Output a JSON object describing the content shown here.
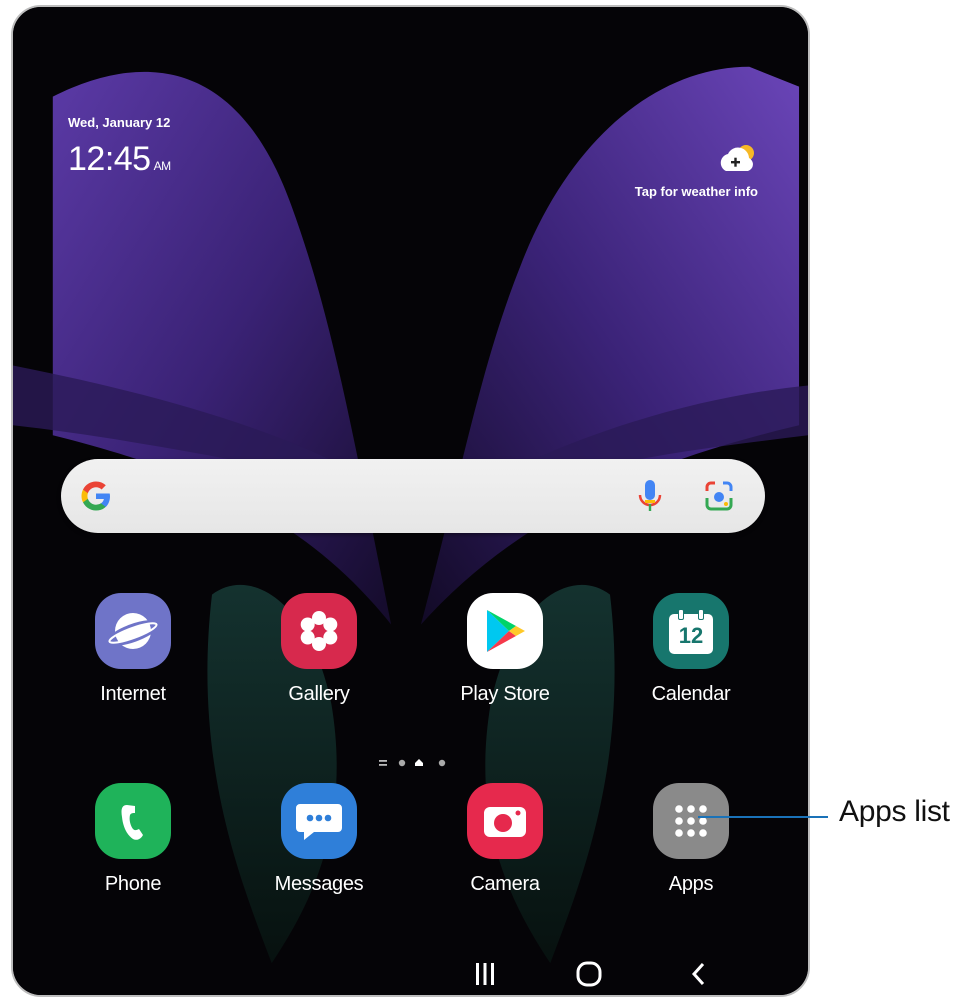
{
  "lockscreen": {
    "date": "Wed, January 12",
    "time": "12:45",
    "ampm": "AM",
    "weather_label": "Tap for weather info"
  },
  "search": {
    "provider": "Google"
  },
  "apps_row1": [
    {
      "label": "Internet",
      "icon": "internet-icon",
      "color": "#6f74c8"
    },
    {
      "label": "Gallery",
      "icon": "gallery-icon",
      "color": "#d7294d"
    },
    {
      "label": "Play Store",
      "icon": "play-store-icon",
      "color": "#ffffff"
    },
    {
      "label": "Calendar",
      "icon": "calendar-icon",
      "color": "#17766d",
      "day": "12"
    }
  ],
  "apps_row2": [
    {
      "label": "Phone",
      "icon": "phone-icon",
      "color": "#1fb35a"
    },
    {
      "label": "Messages",
      "icon": "messages-icon",
      "color": "#2f7fd9"
    },
    {
      "label": "Camera",
      "icon": "camera-icon",
      "color": "#e6294d"
    },
    {
      "label": "Apps",
      "icon": "apps-grid-icon",
      "color": "#8a8a8a"
    }
  ],
  "page_indicator": {
    "pages": 4,
    "current": 3
  },
  "navbar": {
    "recents": "recents-icon",
    "home": "home-icon",
    "back": "back-icon"
  },
  "callout": {
    "label": "Apps list",
    "line_color": "#1a72b8"
  }
}
